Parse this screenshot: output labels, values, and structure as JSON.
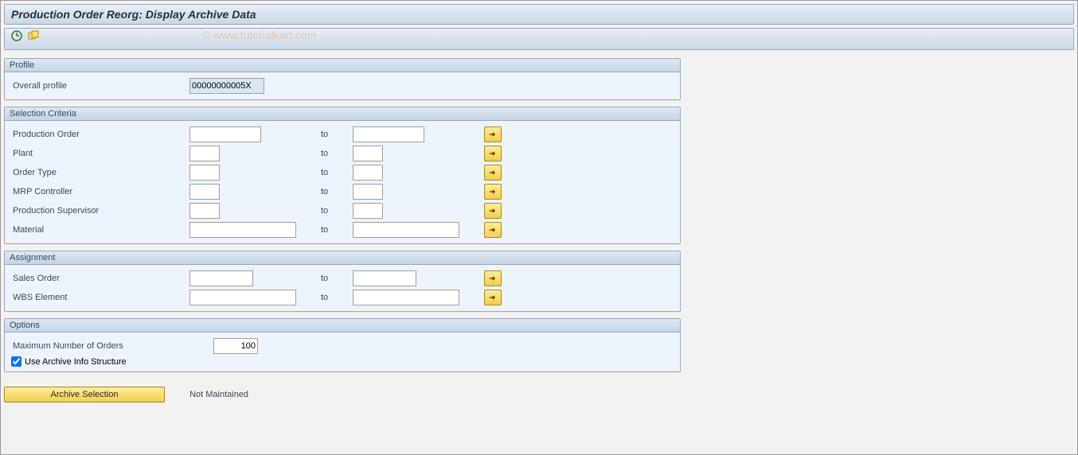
{
  "title": "Production Order Reorg: Display Archive Data",
  "watermark": "© www.tutorialkart.com",
  "profile": {
    "group_title": "Profile",
    "overall_label": "Overall profile",
    "overall_value": "00000000005X"
  },
  "selection": {
    "group_title": "Selection Criteria",
    "to_label": "to",
    "rows": {
      "prod_order": {
        "label": "Production Order",
        "from": "",
        "to": ""
      },
      "plant": {
        "label": "Plant",
        "from": "",
        "to": ""
      },
      "order_type": {
        "label": "Order Type",
        "from": "",
        "to": ""
      },
      "mrp_ctrl": {
        "label": "MRP Controller",
        "from": "",
        "to": ""
      },
      "prod_sup": {
        "label": "Production Supervisor",
        "from": "",
        "to": ""
      },
      "material": {
        "label": "Material",
        "from": "",
        "to": ""
      }
    }
  },
  "assignment": {
    "group_title": "Assignment",
    "to_label": "to",
    "rows": {
      "sales_order": {
        "label": "Sales Order",
        "from": "",
        "to": ""
      },
      "wbs_elem": {
        "label": "WBS Element",
        "from": "",
        "to": ""
      }
    }
  },
  "options": {
    "group_title": "Options",
    "max_label": "Maximum Number of Orders",
    "max_value": "100",
    "archive_struct_label": "Use Archive Info Structure",
    "archive_struct_checked": true
  },
  "footer": {
    "archive_selection_label": "Archive Selection",
    "status_text": "Not Maintained"
  }
}
